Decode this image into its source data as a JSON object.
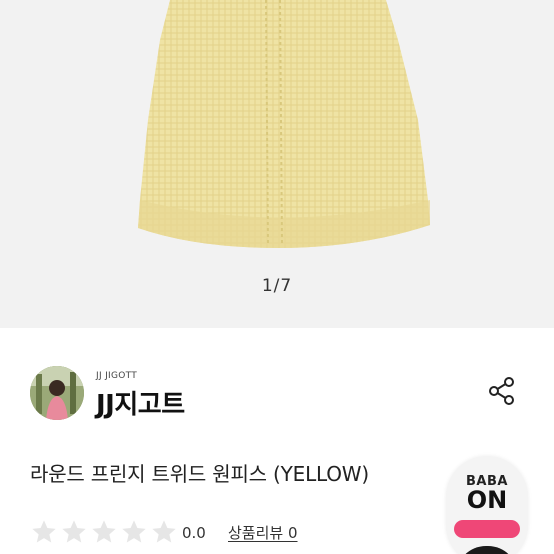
{
  "gallery": {
    "pager": "1/7",
    "dress_color": "#efe2a0"
  },
  "brand": {
    "name_en": "JJ JIGOTT",
    "name_ko": "JJ지고트"
  },
  "product": {
    "title": "라운드 프린지 트위드 원피스 (YELLOW)"
  },
  "rating": {
    "score": "0.0",
    "review_label": "상품리뷰 0",
    "stars_filled": 0,
    "stars_total": 5
  },
  "baba_on": {
    "line1": "BABA",
    "line2": "ON",
    "accent": "#ef4777"
  },
  "icons": {
    "share": "share-icon",
    "star": "star-icon"
  }
}
